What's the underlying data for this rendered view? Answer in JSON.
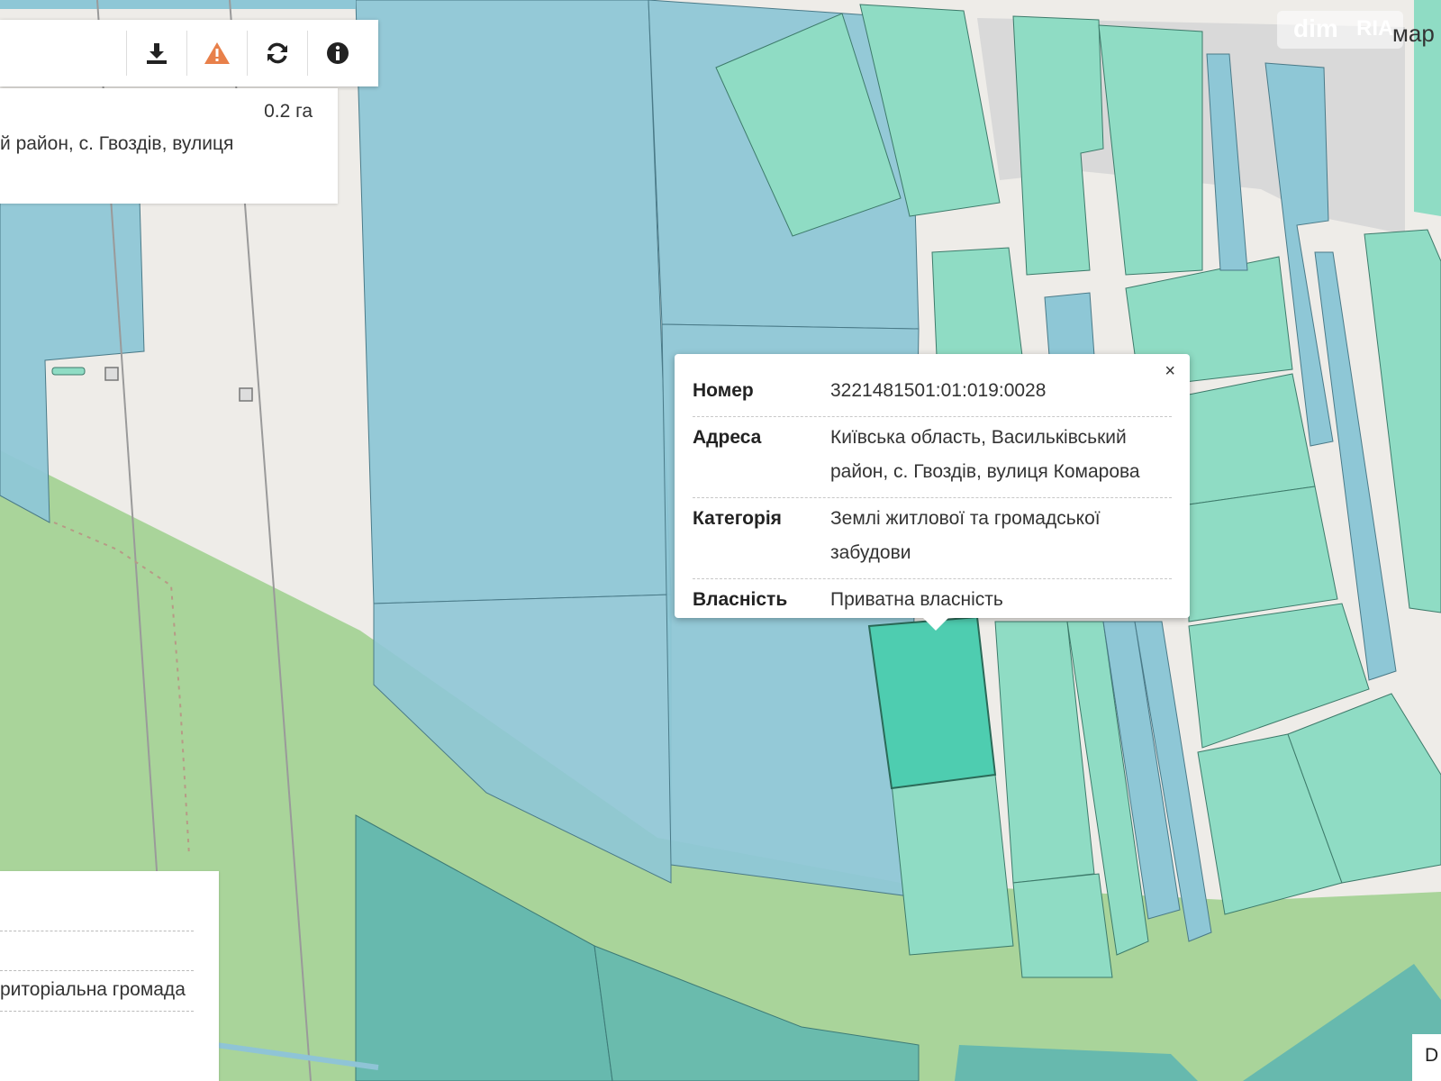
{
  "toolbar": {
    "buttons": [
      {
        "icon": "download-icon"
      },
      {
        "icon": "warning-icon",
        "color": "#e8804a"
      },
      {
        "icon": "refresh-icon"
      },
      {
        "icon": "info-icon"
      }
    ]
  },
  "info_top": {
    "area": "0.2 га",
    "address_fragment": "й район, с. Гвоздів, вулиця"
  },
  "info_bottom": {
    "owner_fragment": "риторіальна громада"
  },
  "popup": {
    "close_label": "×",
    "rows": [
      {
        "key": "Номер",
        "value": "3221481501:01:019:0028"
      },
      {
        "key": "Адреса",
        "value": "Київська область, Васильківський район, с. Гвоздів, вулиця Комарова"
      },
      {
        "key": "Категорія",
        "value": "Землі житлової та громадської забудови"
      },
      {
        "key": "Власність",
        "value": "Приватна власність"
      }
    ]
  },
  "watermark": {
    "part_a": "dim",
    "part_b": "RIA"
  },
  "street_label": "мар",
  "corner_label": "D",
  "colors": {
    "background": "#eeece8",
    "forest": "#a9d49a",
    "state_parcel": "#8ec7d6",
    "private_parcel": "#8fdcc4",
    "selected_parcel": "#4ecdb0",
    "dark_parcel": "#5fb6b0"
  }
}
